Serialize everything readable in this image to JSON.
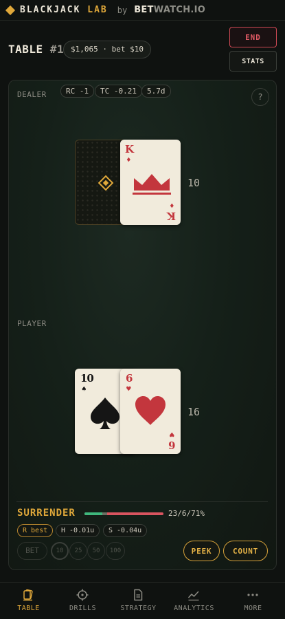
{
  "header": {
    "brand_main": "BLACKJACK",
    "brand_accent": "LAB",
    "by": "by",
    "site_bold": "BET",
    "site_rest": "WATCH.IO"
  },
  "table": {
    "title": "TABLE",
    "number": "#1",
    "balance_pill": "$1,065 · bet $10",
    "end_label": "END",
    "stats_label": "STATS"
  },
  "dealer": {
    "label": "DEALER",
    "running_count": "RC -1",
    "true_count": "TC -0.21",
    "decks": "5.7d",
    "help": "?",
    "total": "10",
    "up_card": {
      "rank": "K",
      "suit": "♦"
    }
  },
  "player": {
    "label": "PLAYER",
    "total": "16",
    "cards": [
      {
        "rank": "10",
        "suit": "♠"
      },
      {
        "rank": "6",
        "suit": "♥"
      }
    ]
  },
  "advice": {
    "action": "SURRENDER",
    "odds": "23/6/71%",
    "bar": {
      "win": 0.23,
      "push": 0.06,
      "loss": 0.71
    },
    "tags": [
      "R best",
      "H -0.01u",
      "S -0.04u"
    ]
  },
  "betting": {
    "bet_label": "BET",
    "chips": [
      "10",
      "25",
      "50",
      "100"
    ],
    "peek_label": "PEEK",
    "count_label": "COUNT"
  },
  "nav": {
    "items": [
      "TABLE",
      "DRILLS",
      "STRATEGY",
      "ANALYTICS",
      "MORE"
    ]
  },
  "colors": {
    "accent": "#e0a83a",
    "danger": "#d04a55",
    "positive": "#3fb87d",
    "card_red": "#c3363d"
  }
}
